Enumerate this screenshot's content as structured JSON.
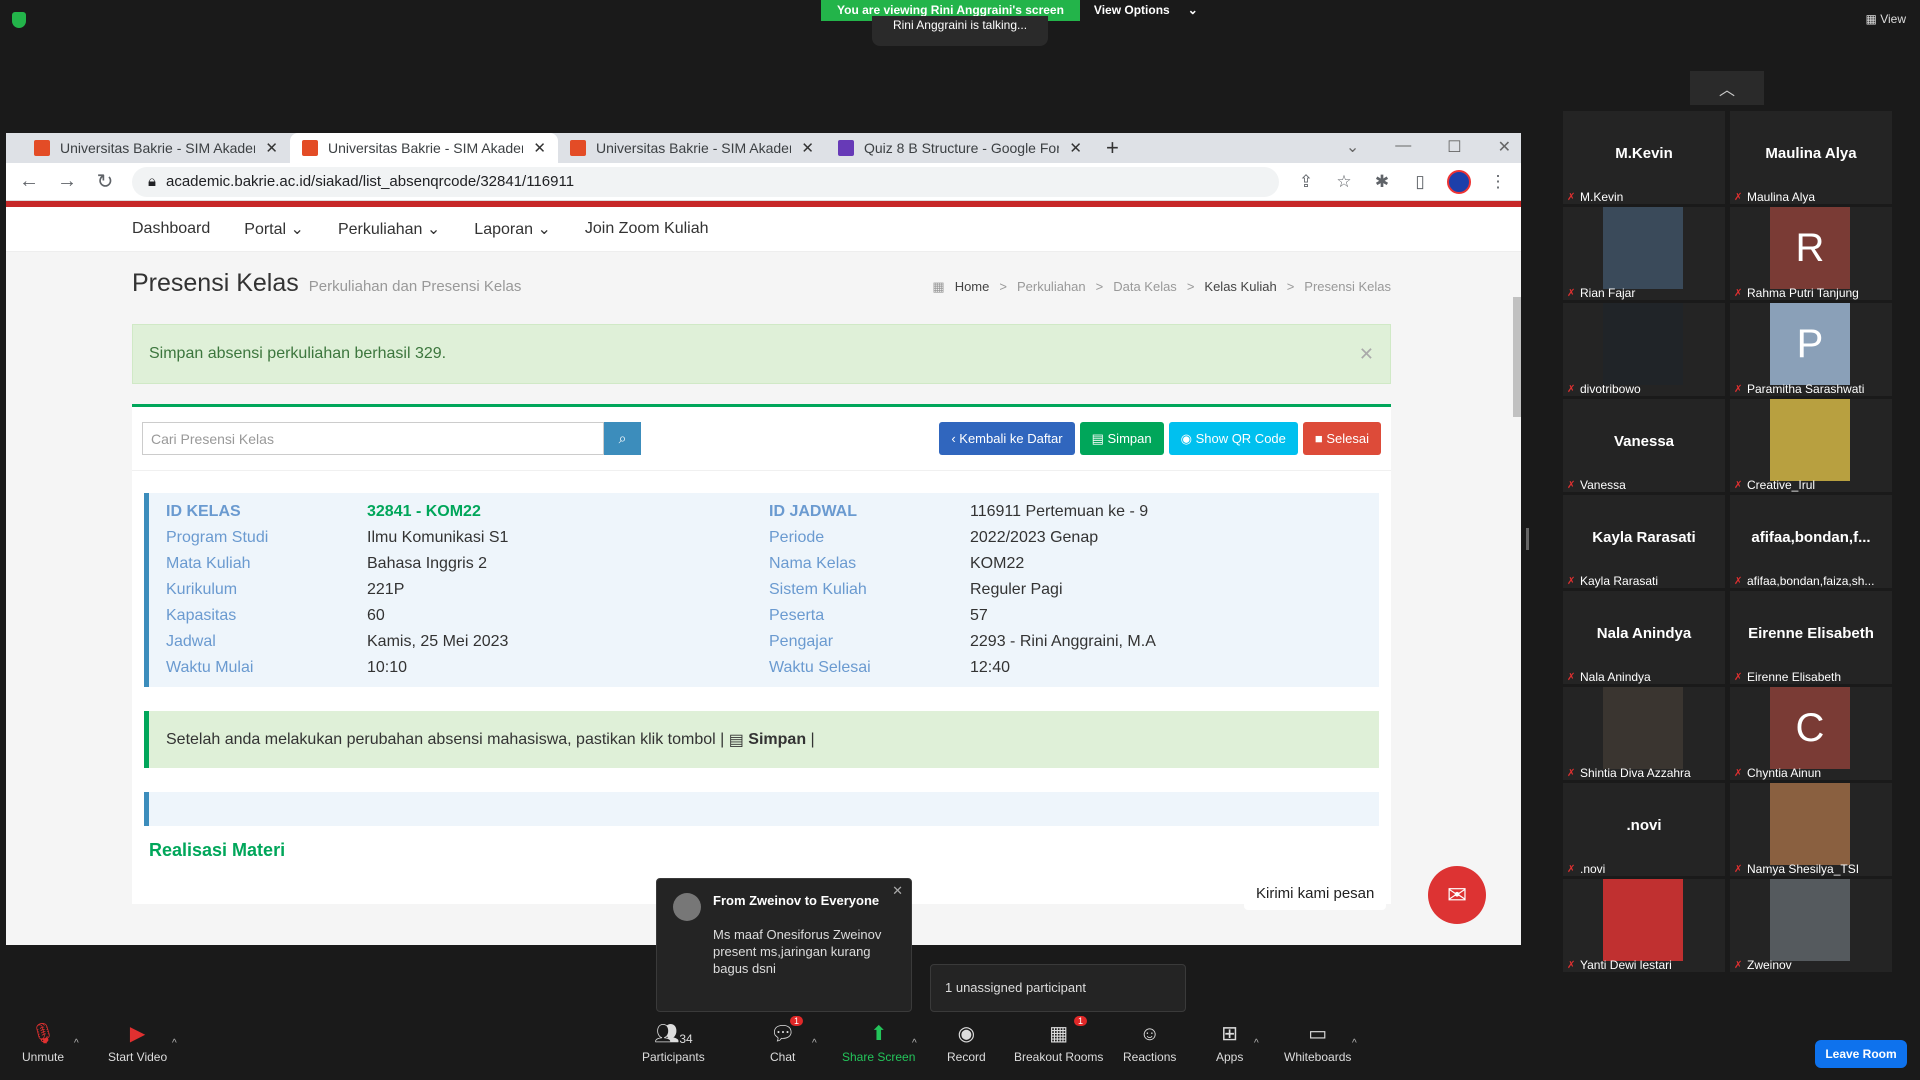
{
  "zoom": {
    "viewing_banner": "You are viewing Rini Anggraini's screen",
    "view_options": "View Options",
    "talking": "Rini Anggraini is talking...",
    "view_label": "View",
    "unassigned": "1 unassigned participant",
    "chat_popup": {
      "from": "From Zweinov to Everyone",
      "message": "Ms maaf Onesiforus Zweinov present ms,jaringan kurang bagus dsni"
    },
    "kirimi": "Kirimi kami pesan",
    "leave": "Leave Room",
    "toolbar": {
      "unmute": "Unmute",
      "start_video": "Start Video",
      "participants": "Participants",
      "participants_count": "34",
      "chat": "Chat",
      "chat_badge": "1",
      "share_screen": "Share Screen",
      "record": "Record",
      "breakout": "Breakout Rooms",
      "breakout_badge": "1",
      "reactions": "Reactions",
      "apps": "Apps",
      "whiteboards": "Whiteboards"
    },
    "participants": [
      {
        "big": "M.Kevin",
        "name": "M.Kevin",
        "pic": ""
      },
      {
        "big": "Maulina Alya",
        "name": "Maulina Alya",
        "pic": ""
      },
      {
        "big": "",
        "name": "Rian Fajar",
        "pic": "photo",
        "color": "#3a4a5a"
      },
      {
        "big": "",
        "name": "Rahma Putri Tanjung",
        "pic": "R",
        "color": "#7a3b35"
      },
      {
        "big": "",
        "name": "divotribowo",
        "pic": "photo",
        "color": "#202428"
      },
      {
        "big": "",
        "name": "Paramitha Sarashwati",
        "pic": "P",
        "color": "#8aa0b8"
      },
      {
        "big": "Vanessa",
        "name": "Vanessa",
        "pic": ""
      },
      {
        "big": "",
        "name": "Creative_Irul",
        "pic": "photo",
        "color": "#b8a040"
      },
      {
        "big": "Kayla Rarasati",
        "name": "Kayla Rarasati",
        "pic": ""
      },
      {
        "big": "afifaa,bondan,f...",
        "name": "afifaa,bondan,faiza,sh...",
        "pic": ""
      },
      {
        "big": "Nala Anindya",
        "name": "Nala Anindya",
        "pic": ""
      },
      {
        "big": "Eirenne Elisabeth",
        "name": "Eirenne Elisabeth",
        "pic": ""
      },
      {
        "big": "",
        "name": "Shintia Diva Azzahra",
        "pic": "photo",
        "color": "#3a3530"
      },
      {
        "big": "",
        "name": "Chyntia Ainun",
        "pic": "C",
        "color": "#7a3b35"
      },
      {
        "big": ".novi",
        "name": ".novi",
        "pic": ""
      },
      {
        "big": "",
        "name": "Namya Shesilya_TSI",
        "pic": "photo",
        "color": "#8a6040"
      },
      {
        "big": "",
        "name": "Yanti Dewi lestari",
        "pic": "photo",
        "color": "#c03030"
      },
      {
        "big": "",
        "name": "Zweinov",
        "pic": "photo",
        "color": "#555a5e"
      }
    ]
  },
  "browser": {
    "tabs": [
      {
        "title": "Universitas Bakrie - SIM Akadem",
        "icon": "bakrie-icon"
      },
      {
        "title": "Universitas Bakrie - SIM Akadem",
        "icon": "bakrie-icon"
      },
      {
        "title": "Universitas Bakrie - SIM Akadem",
        "icon": "bakrie-icon"
      },
      {
        "title": "Quiz 8 B Structure - Google Form",
        "icon": "forms-icon"
      }
    ],
    "url": "academic.bakrie.ac.id/siakad/list_absenqrcode/32841/116911"
  },
  "site": {
    "nav": [
      "Dashboard",
      "Portal",
      "Perkuliahan",
      "Laporan",
      "Join Zoom Kuliah"
    ],
    "title": "Presensi Kelas",
    "subtitle": "Perkuliahan dan Presensi Kelas",
    "breadcrumb": [
      "Home",
      "Perkuliahan",
      "Data Kelas",
      "Kelas Kuliah",
      "Presensi Kelas"
    ],
    "alert": "Simpan absensi perkuliahan berhasil 329.",
    "search_placeholder": "Cari Presensi Kelas",
    "buttons": {
      "back": "Kembali ke Daftar",
      "save": "Simpan",
      "qr": "Show QR Code",
      "done": "Selesai"
    },
    "info": [
      [
        "ID KELAS",
        "32841 - KOM22",
        "ID JADWAL",
        "116911 Pertemuan ke - 9"
      ],
      [
        "Program Studi",
        "Ilmu Komunikasi S1",
        "Periode",
        "2022/2023 Genap"
      ],
      [
        "Mata Kuliah",
        "Bahasa Inggris 2",
        "Nama Kelas",
        "KOM22"
      ],
      [
        "Kurikulum",
        "221P",
        "Sistem Kuliah",
        "Reguler Pagi"
      ],
      [
        "Kapasitas",
        "60",
        "Peserta",
        "57"
      ],
      [
        "Jadwal",
        "Kamis, 25 Mei 2023",
        "Pengajar",
        "2293 - Rini Anggraini, M.A"
      ],
      [
        "Waktu Mulai",
        "10:10",
        "Waktu Selesai",
        "12:40"
      ]
    ],
    "notice_text": "Setelah anda melakukan perubahan absensi mahasiswa, pastikan klik tombol |",
    "notice_bold": "Simpan",
    "notice_end": "|",
    "realisasi": "Realisasi Materi"
  }
}
